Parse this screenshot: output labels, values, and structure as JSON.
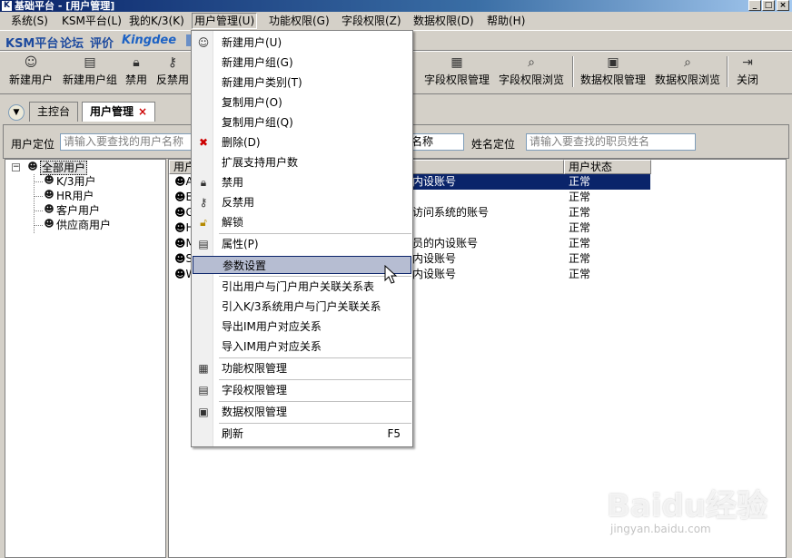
{
  "window": {
    "title": "基础平台 - [用户管理]",
    "app_icon": "K",
    "controls": [
      "_",
      "□",
      "×"
    ]
  },
  "menubar": {
    "items": [
      {
        "label": "系统(S)"
      },
      {
        "label": "KSM平台(L)"
      },
      {
        "label": "我的K/3(K)"
      },
      {
        "label": "用户管理(U)"
      },
      {
        "label": "功能权限(G)"
      },
      {
        "label": "字段权限(Z)"
      },
      {
        "label": "数据权限(D)"
      },
      {
        "label": "帮助(H)"
      }
    ]
  },
  "brandbar": {
    "links": [
      "KSM平台",
      "论坛",
      "评价"
    ],
    "logo": "Kingdee"
  },
  "toolbar": {
    "buttons": [
      {
        "label": "新建用户",
        "icon": "new-user-icon"
      },
      {
        "label": "新建用户组",
        "icon": "new-group-icon"
      },
      {
        "label": "禁用",
        "icon": "lock-icon"
      },
      {
        "label": "反禁用",
        "icon": "key-icon"
      },
      {
        "label": "字段权限管理",
        "icon": "field-permission-icon"
      },
      {
        "label": "字段权限浏览",
        "icon": "field-browse-icon"
      },
      {
        "label": "数据权限管理",
        "icon": "data-permission-icon"
      },
      {
        "label": "数据权限浏览",
        "icon": "data-browse-icon"
      },
      {
        "label": "关闭",
        "icon": "exit-icon"
      }
    ]
  },
  "tabs": [
    {
      "label": "主控台"
    },
    {
      "label": "用户管理",
      "close": "×"
    }
  ],
  "search": {
    "user_locate_label": "用户定位",
    "user_locate_placeholder": "请输入要查找的用户名称",
    "middle_field_text": "名称",
    "name_locate_label": "姓名定位",
    "name_locate_placeholder": "请输入要查找的职员姓名"
  },
  "tree": {
    "root": "全部用户",
    "children": [
      "K/3用户",
      "HR用户",
      "客户用户",
      "供应商用户"
    ]
  },
  "list": {
    "headers": [
      "用户",
      "用户状态"
    ],
    "rows": [
      {
        "name_initial": "A",
        "desc": "内设账号",
        "status": "正常"
      },
      {
        "name_initial": "E",
        "desc": "",
        "status": "正常"
      },
      {
        "name_initial": "G",
        "desc": "访问系统的账号",
        "status": "正常"
      },
      {
        "name_initial": "H",
        "desc": "",
        "status": "正常"
      },
      {
        "name_initial": "M",
        "desc": "员的内设账号",
        "status": "正常"
      },
      {
        "name_initial": "S",
        "desc": "内设账号",
        "status": "正常"
      },
      {
        "name_initial": "W",
        "desc": "内设账号",
        "status": "正常"
      }
    ]
  },
  "dropdown": {
    "items": [
      {
        "label": "新建用户(U)",
        "icon": "new-user-icon"
      },
      {
        "label": "新建用户组(G)",
        "icon": ""
      },
      {
        "label": "新建用户类别(T)",
        "icon": ""
      },
      {
        "label": "复制用户(O)",
        "icon": ""
      },
      {
        "label": "复制用户组(Q)",
        "icon": ""
      },
      {
        "label": "删除(D)",
        "icon": "delete-icon"
      },
      {
        "label": "扩展支持用户数",
        "icon": ""
      },
      {
        "label": "禁用",
        "icon": "lock-icon"
      },
      {
        "label": "反禁用",
        "icon": "key-icon"
      },
      {
        "label": "解锁",
        "icon": "unlock-icon"
      },
      {
        "label": "属性(P)",
        "icon": "properties-icon"
      },
      {
        "label": "参数设置",
        "icon": ""
      },
      {
        "label": "引出用户与门户用户关联关系表",
        "icon": ""
      },
      {
        "label": "引入K/3系统用户与门户关联关系",
        "icon": ""
      },
      {
        "label": "导出IM用户对应关系",
        "icon": ""
      },
      {
        "label": "导入IM用户对应关系",
        "icon": ""
      },
      {
        "label": "功能权限管理",
        "icon": "function-permission-icon"
      },
      {
        "label": "字段权限管理",
        "icon": "field-permission-icon"
      },
      {
        "label": "数据权限管理",
        "icon": "data-permission-icon"
      },
      {
        "label": "刷新",
        "icon": "",
        "shortcut": "F5"
      }
    ],
    "highlighted": "参数设置"
  },
  "watermark": {
    "logo": "Baidu经验",
    "url": "jingyan.baidu.com"
  }
}
